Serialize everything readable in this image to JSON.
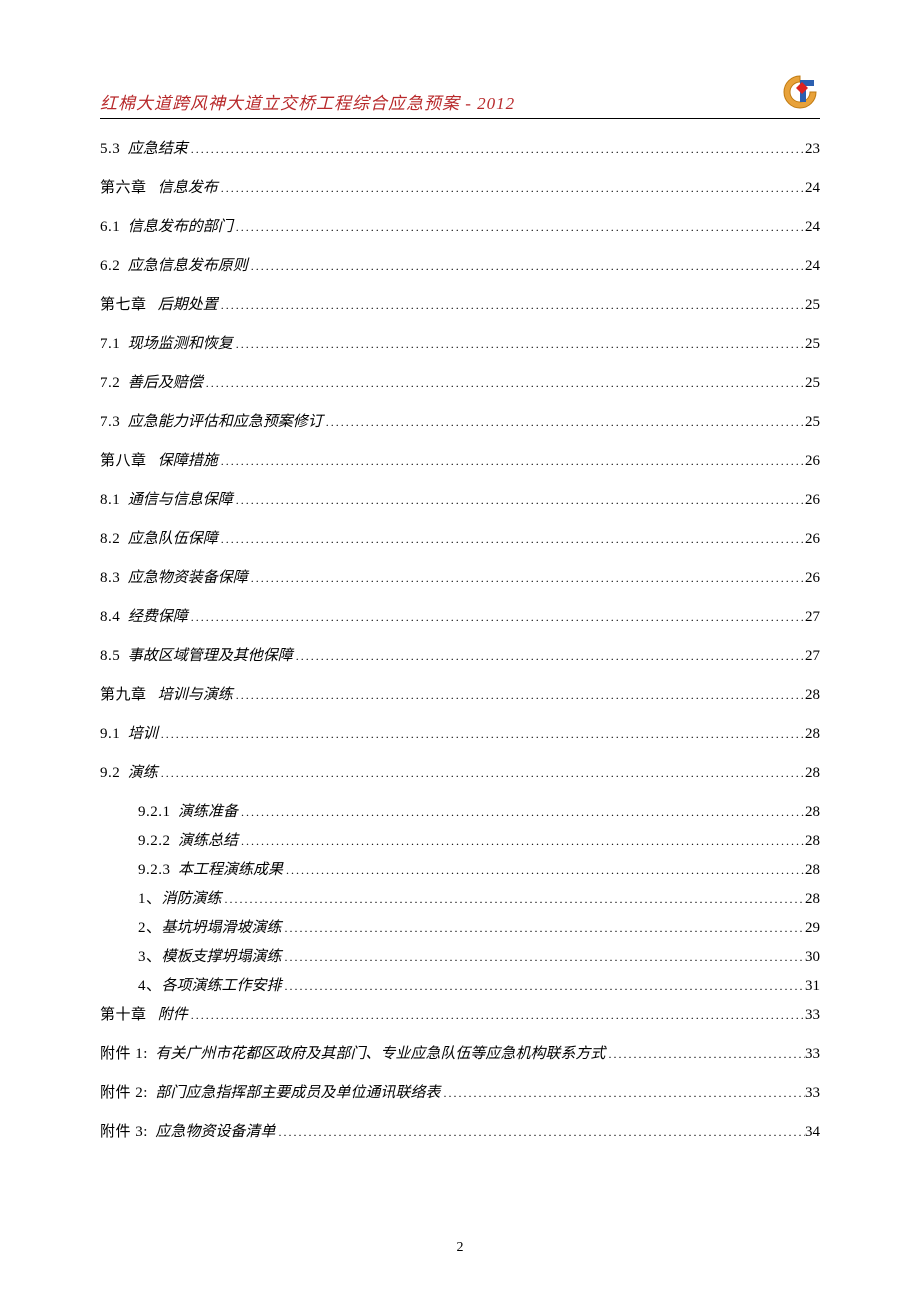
{
  "header": {
    "title": "红棉大道跨风神大道立交桥工程综合应急预案 - 2012"
  },
  "toc": [
    {
      "level": 1,
      "number": "5.3",
      "title": "应急结束",
      "page": "23"
    },
    {
      "level": 1,
      "number": "第六章",
      "title": "信息发布",
      "page": "24",
      "chapter": true
    },
    {
      "level": 1,
      "number": "6.1",
      "title": "信息发布的部门",
      "page": "24"
    },
    {
      "level": 1,
      "number": "6.2",
      "title": "应急信息发布原则",
      "page": "24"
    },
    {
      "level": 1,
      "number": "第七章",
      "title": "后期处置",
      "page": "25",
      "chapter": true
    },
    {
      "level": 1,
      "number": "7.1",
      "title": "现场监测和恢复",
      "page": "25"
    },
    {
      "level": 1,
      "number": "7.2",
      "title": "善后及赔偿",
      "page": "25"
    },
    {
      "level": 1,
      "number": "7.3",
      "title": "应急能力评估和应急预案修订",
      "page": "25"
    },
    {
      "level": 1,
      "number": "第八章",
      "title": "保障措施",
      "page": "26",
      "chapter": true
    },
    {
      "level": 1,
      "number": "8.1",
      "title": "通信与信息保障",
      "page": "26"
    },
    {
      "level": 1,
      "number": "8.2",
      "title": "应急队伍保障",
      "page": "26"
    },
    {
      "level": 1,
      "number": "8.3",
      "title": "应急物资装备保障",
      "page": "26"
    },
    {
      "level": 1,
      "number": "8.4",
      "title": "经费保障",
      "page": "27"
    },
    {
      "level": 1,
      "number": "8.5",
      "title": "事故区域管理及其他保障",
      "page": "27"
    },
    {
      "level": 1,
      "number": "第九章",
      "title": "培训与演练",
      "page": "28",
      "chapter": true
    },
    {
      "level": 1,
      "number": "9.1",
      "title": "培训",
      "page": "28"
    },
    {
      "level": 1,
      "number": "9.2",
      "title": "演练",
      "page": "28"
    },
    {
      "level": 2,
      "number": "9.2.1",
      "title": "演练准备",
      "page": "28"
    },
    {
      "level": 2,
      "number": "9.2.2",
      "title": "演练总结",
      "page": "28"
    },
    {
      "level": 2,
      "number": "9.2.3",
      "title": "本工程演练成果",
      "page": "28"
    },
    {
      "level": 2,
      "number": "1、",
      "title": "消防演练",
      "page": "28",
      "plain": true
    },
    {
      "level": 2,
      "number": "2、",
      "title": "基坑坍塌滑坡演练",
      "page": "29",
      "plain": true
    },
    {
      "level": 2,
      "number": "3、",
      "title": "模板支撑坍塌演练",
      "page": "30",
      "plain": true
    },
    {
      "level": 2,
      "number": "4、",
      "title": "各项演练工作安排",
      "page": "31",
      "plain": true
    },
    {
      "level": 1,
      "number": "第十章",
      "title": "附件",
      "page": "33",
      "chapter": true
    },
    {
      "level": 1,
      "number": "附件 1:",
      "title": "有关广州市花都区政府及其部门、专业应急队伍等应急机构联系方式",
      "page": "33"
    },
    {
      "level": 1,
      "number": "附件 2:",
      "title": "部门应急指挥部主要成员及单位通讯联络表",
      "page": "33"
    },
    {
      "level": 1,
      "number": "附件 3:",
      "title": "应急物资设备清单",
      "page": "34"
    }
  ],
  "pageNumber": "2"
}
